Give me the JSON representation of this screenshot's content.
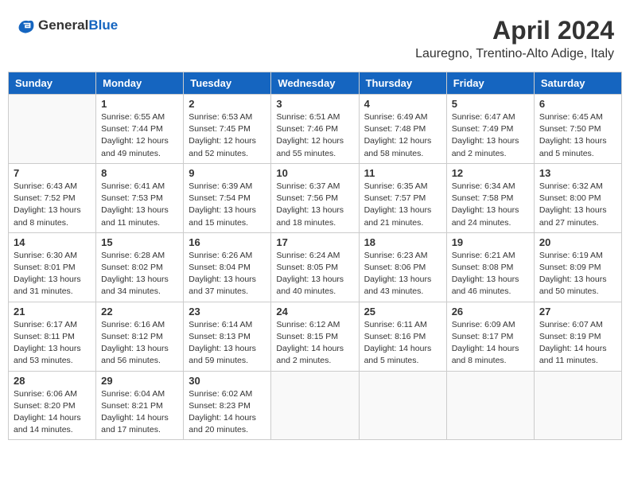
{
  "logo": {
    "text_general": "General",
    "text_blue": "Blue"
  },
  "title": "April 2024",
  "subtitle": "Lauregno, Trentino-Alto Adige, Italy",
  "days_of_week": [
    "Sunday",
    "Monday",
    "Tuesday",
    "Wednesday",
    "Thursday",
    "Friday",
    "Saturday"
  ],
  "weeks": [
    [
      {
        "day": "",
        "sunrise": "",
        "sunset": "",
        "daylight": ""
      },
      {
        "day": "1",
        "sunrise": "Sunrise: 6:55 AM",
        "sunset": "Sunset: 7:44 PM",
        "daylight": "Daylight: 12 hours and 49 minutes."
      },
      {
        "day": "2",
        "sunrise": "Sunrise: 6:53 AM",
        "sunset": "Sunset: 7:45 PM",
        "daylight": "Daylight: 12 hours and 52 minutes."
      },
      {
        "day": "3",
        "sunrise": "Sunrise: 6:51 AM",
        "sunset": "Sunset: 7:46 PM",
        "daylight": "Daylight: 12 hours and 55 minutes."
      },
      {
        "day": "4",
        "sunrise": "Sunrise: 6:49 AM",
        "sunset": "Sunset: 7:48 PM",
        "daylight": "Daylight: 12 hours and 58 minutes."
      },
      {
        "day": "5",
        "sunrise": "Sunrise: 6:47 AM",
        "sunset": "Sunset: 7:49 PM",
        "daylight": "Daylight: 13 hours and 2 minutes."
      },
      {
        "day": "6",
        "sunrise": "Sunrise: 6:45 AM",
        "sunset": "Sunset: 7:50 PM",
        "daylight": "Daylight: 13 hours and 5 minutes."
      }
    ],
    [
      {
        "day": "7",
        "sunrise": "Sunrise: 6:43 AM",
        "sunset": "Sunset: 7:52 PM",
        "daylight": "Daylight: 13 hours and 8 minutes."
      },
      {
        "day": "8",
        "sunrise": "Sunrise: 6:41 AM",
        "sunset": "Sunset: 7:53 PM",
        "daylight": "Daylight: 13 hours and 11 minutes."
      },
      {
        "day": "9",
        "sunrise": "Sunrise: 6:39 AM",
        "sunset": "Sunset: 7:54 PM",
        "daylight": "Daylight: 13 hours and 15 minutes."
      },
      {
        "day": "10",
        "sunrise": "Sunrise: 6:37 AM",
        "sunset": "Sunset: 7:56 PM",
        "daylight": "Daylight: 13 hours and 18 minutes."
      },
      {
        "day": "11",
        "sunrise": "Sunrise: 6:35 AM",
        "sunset": "Sunset: 7:57 PM",
        "daylight": "Daylight: 13 hours and 21 minutes."
      },
      {
        "day": "12",
        "sunrise": "Sunrise: 6:34 AM",
        "sunset": "Sunset: 7:58 PM",
        "daylight": "Daylight: 13 hours and 24 minutes."
      },
      {
        "day": "13",
        "sunrise": "Sunrise: 6:32 AM",
        "sunset": "Sunset: 8:00 PM",
        "daylight": "Daylight: 13 hours and 27 minutes."
      }
    ],
    [
      {
        "day": "14",
        "sunrise": "Sunrise: 6:30 AM",
        "sunset": "Sunset: 8:01 PM",
        "daylight": "Daylight: 13 hours and 31 minutes."
      },
      {
        "day": "15",
        "sunrise": "Sunrise: 6:28 AM",
        "sunset": "Sunset: 8:02 PM",
        "daylight": "Daylight: 13 hours and 34 minutes."
      },
      {
        "day": "16",
        "sunrise": "Sunrise: 6:26 AM",
        "sunset": "Sunset: 8:04 PM",
        "daylight": "Daylight: 13 hours and 37 minutes."
      },
      {
        "day": "17",
        "sunrise": "Sunrise: 6:24 AM",
        "sunset": "Sunset: 8:05 PM",
        "daylight": "Daylight: 13 hours and 40 minutes."
      },
      {
        "day": "18",
        "sunrise": "Sunrise: 6:23 AM",
        "sunset": "Sunset: 8:06 PM",
        "daylight": "Daylight: 13 hours and 43 minutes."
      },
      {
        "day": "19",
        "sunrise": "Sunrise: 6:21 AM",
        "sunset": "Sunset: 8:08 PM",
        "daylight": "Daylight: 13 hours and 46 minutes."
      },
      {
        "day": "20",
        "sunrise": "Sunrise: 6:19 AM",
        "sunset": "Sunset: 8:09 PM",
        "daylight": "Daylight: 13 hours and 50 minutes."
      }
    ],
    [
      {
        "day": "21",
        "sunrise": "Sunrise: 6:17 AM",
        "sunset": "Sunset: 8:11 PM",
        "daylight": "Daylight: 13 hours and 53 minutes."
      },
      {
        "day": "22",
        "sunrise": "Sunrise: 6:16 AM",
        "sunset": "Sunset: 8:12 PM",
        "daylight": "Daylight: 13 hours and 56 minutes."
      },
      {
        "day": "23",
        "sunrise": "Sunrise: 6:14 AM",
        "sunset": "Sunset: 8:13 PM",
        "daylight": "Daylight: 13 hours and 59 minutes."
      },
      {
        "day": "24",
        "sunrise": "Sunrise: 6:12 AM",
        "sunset": "Sunset: 8:15 PM",
        "daylight": "Daylight: 14 hours and 2 minutes."
      },
      {
        "day": "25",
        "sunrise": "Sunrise: 6:11 AM",
        "sunset": "Sunset: 8:16 PM",
        "daylight": "Daylight: 14 hours and 5 minutes."
      },
      {
        "day": "26",
        "sunrise": "Sunrise: 6:09 AM",
        "sunset": "Sunset: 8:17 PM",
        "daylight": "Daylight: 14 hours and 8 minutes."
      },
      {
        "day": "27",
        "sunrise": "Sunrise: 6:07 AM",
        "sunset": "Sunset: 8:19 PM",
        "daylight": "Daylight: 14 hours and 11 minutes."
      }
    ],
    [
      {
        "day": "28",
        "sunrise": "Sunrise: 6:06 AM",
        "sunset": "Sunset: 8:20 PM",
        "daylight": "Daylight: 14 hours and 14 minutes."
      },
      {
        "day": "29",
        "sunrise": "Sunrise: 6:04 AM",
        "sunset": "Sunset: 8:21 PM",
        "daylight": "Daylight: 14 hours and 17 minutes."
      },
      {
        "day": "30",
        "sunrise": "Sunrise: 6:02 AM",
        "sunset": "Sunset: 8:23 PM",
        "daylight": "Daylight: 14 hours and 20 minutes."
      },
      {
        "day": "",
        "sunrise": "",
        "sunset": "",
        "daylight": ""
      },
      {
        "day": "",
        "sunrise": "",
        "sunset": "",
        "daylight": ""
      },
      {
        "day": "",
        "sunrise": "",
        "sunset": "",
        "daylight": ""
      },
      {
        "day": "",
        "sunrise": "",
        "sunset": "",
        "daylight": ""
      }
    ]
  ]
}
